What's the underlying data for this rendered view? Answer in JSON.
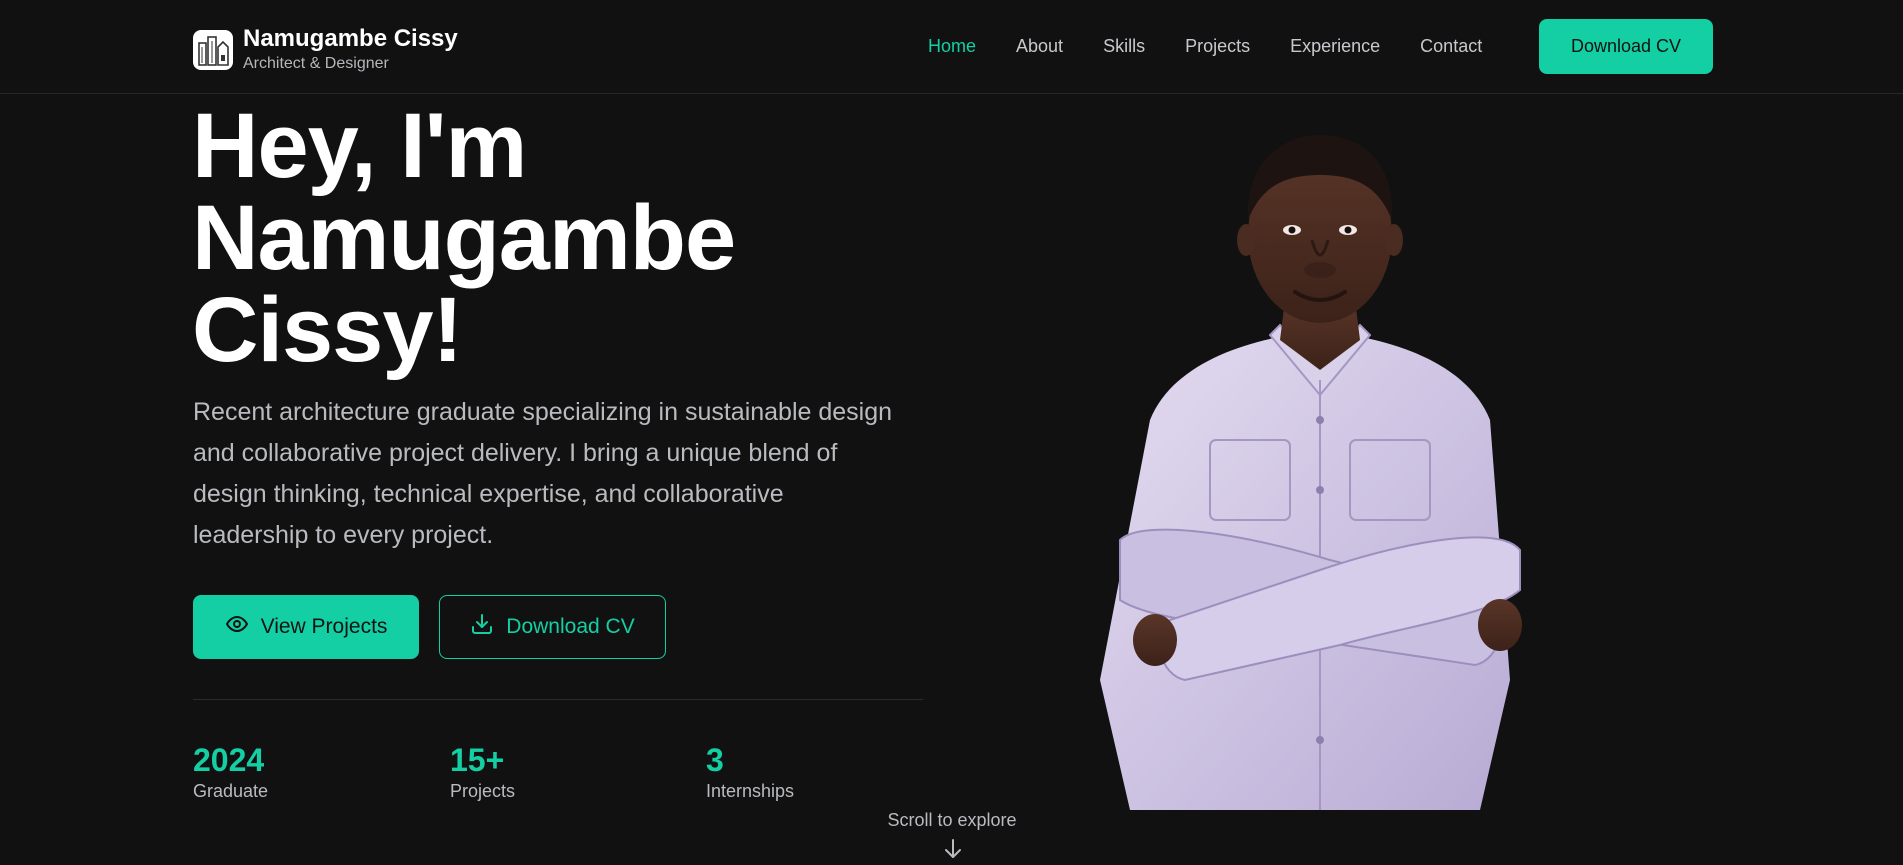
{
  "header": {
    "brand_name": "Namugambe Cissy",
    "brand_subtitle": "Architect & Designer",
    "nav": [
      {
        "label": "Home",
        "active": true
      },
      {
        "label": "About",
        "active": false
      },
      {
        "label": "Skills",
        "active": false
      },
      {
        "label": "Projects",
        "active": false
      },
      {
        "label": "Experience",
        "active": false
      },
      {
        "label": "Contact",
        "active": false
      }
    ],
    "cv_button": "Download CV"
  },
  "hero": {
    "title_lines": [
      "Hey, I'm",
      "Namugambe",
      "Cissy!"
    ],
    "description": "Recent architecture graduate specializing in sustainable design and collaborative project delivery. I bring a unique blend of design thinking, technical expertise, and collaborative leadership to every project.",
    "primary_button": "View Projects",
    "secondary_button": "Download CV",
    "stats": [
      {
        "value": "2024",
        "label": "Graduate"
      },
      {
        "value": "15+",
        "label": "Projects"
      },
      {
        "value": "3",
        "label": "Internships"
      }
    ],
    "scroll_hint": "Scroll to explore"
  },
  "icons": {
    "logo": "building-logo-icon",
    "view": "eye-icon",
    "download": "download-icon",
    "scroll": "arrow-down-icon"
  },
  "colors": {
    "accent": "#14cfa4",
    "background": "#111112",
    "text_muted": "#b9bbbf",
    "shirt": "#cfc4e2",
    "skin": "#4a2c22"
  }
}
